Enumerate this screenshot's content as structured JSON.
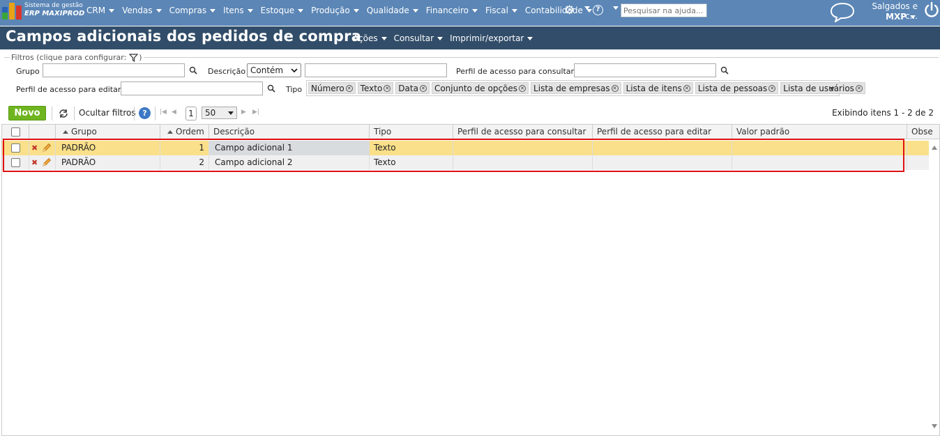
{
  "app": {
    "brand_line1": "Sistema de gestão",
    "brand_line2": "ERP MAXIPROD",
    "menu": [
      "CRM",
      "Vendas",
      "Compras",
      "Itens",
      "Estoque",
      "Produção",
      "Qualidade",
      "Financeiro",
      "Fiscal",
      "Contabilidade"
    ],
    "search_placeholder": "Pesquisar na ajuda...",
    "company": "Salgados e c...",
    "user": "MXP"
  },
  "page": {
    "title": "Campos adicionais dos pedidos de compra",
    "title_menu": [
      "Ações",
      "Consultar",
      "Imprimir/exportar"
    ]
  },
  "filters": {
    "legend": "Filtros (clique para configurar:",
    "legend_end": ")",
    "grupo_label": "Grupo",
    "descricao_label": "Descrição",
    "descricao_operator": "Contém",
    "perfil_consultar_label": "Perfil de acesso para consultar",
    "perfil_editar_label": "Perfil de acesso para editar",
    "tipo_label": "Tipo",
    "tipo_tags": [
      "Número",
      "Texto",
      "Data",
      "Conjunto de opções",
      "Lista de empresas",
      "Lista de itens",
      "Lista de pessoas",
      "Lista de usuários"
    ]
  },
  "toolbar": {
    "novo": "Novo",
    "ocultar_filtros": "Ocultar filtros",
    "help": "?",
    "page": "1",
    "page_size": "50",
    "exibindo": "Exibindo itens 1 - 2 de 2"
  },
  "grid": {
    "columns": [
      "Grupo",
      "Ordem",
      "Descrição",
      "Tipo",
      "Perfil de acesso para consultar",
      "Perfil de acesso para editar",
      "Valor padrão",
      "Obse"
    ],
    "rows": [
      {
        "grupo": "PADRÃO",
        "ordem": "1",
        "descricao": "Campo adicional 1",
        "tipo": "Texto"
      },
      {
        "grupo": "PADRÃO",
        "ordem": "2",
        "descricao": "Campo adicional 2",
        "tipo": "Texto"
      }
    ]
  },
  "colors": {
    "topbar": "#5b86b6",
    "titlebar": "#314d69",
    "novo_button": "#6fb51f",
    "row_selected": "#fae08a",
    "row_alt": "#f0f0f0",
    "highlight_border": "#e01010"
  }
}
